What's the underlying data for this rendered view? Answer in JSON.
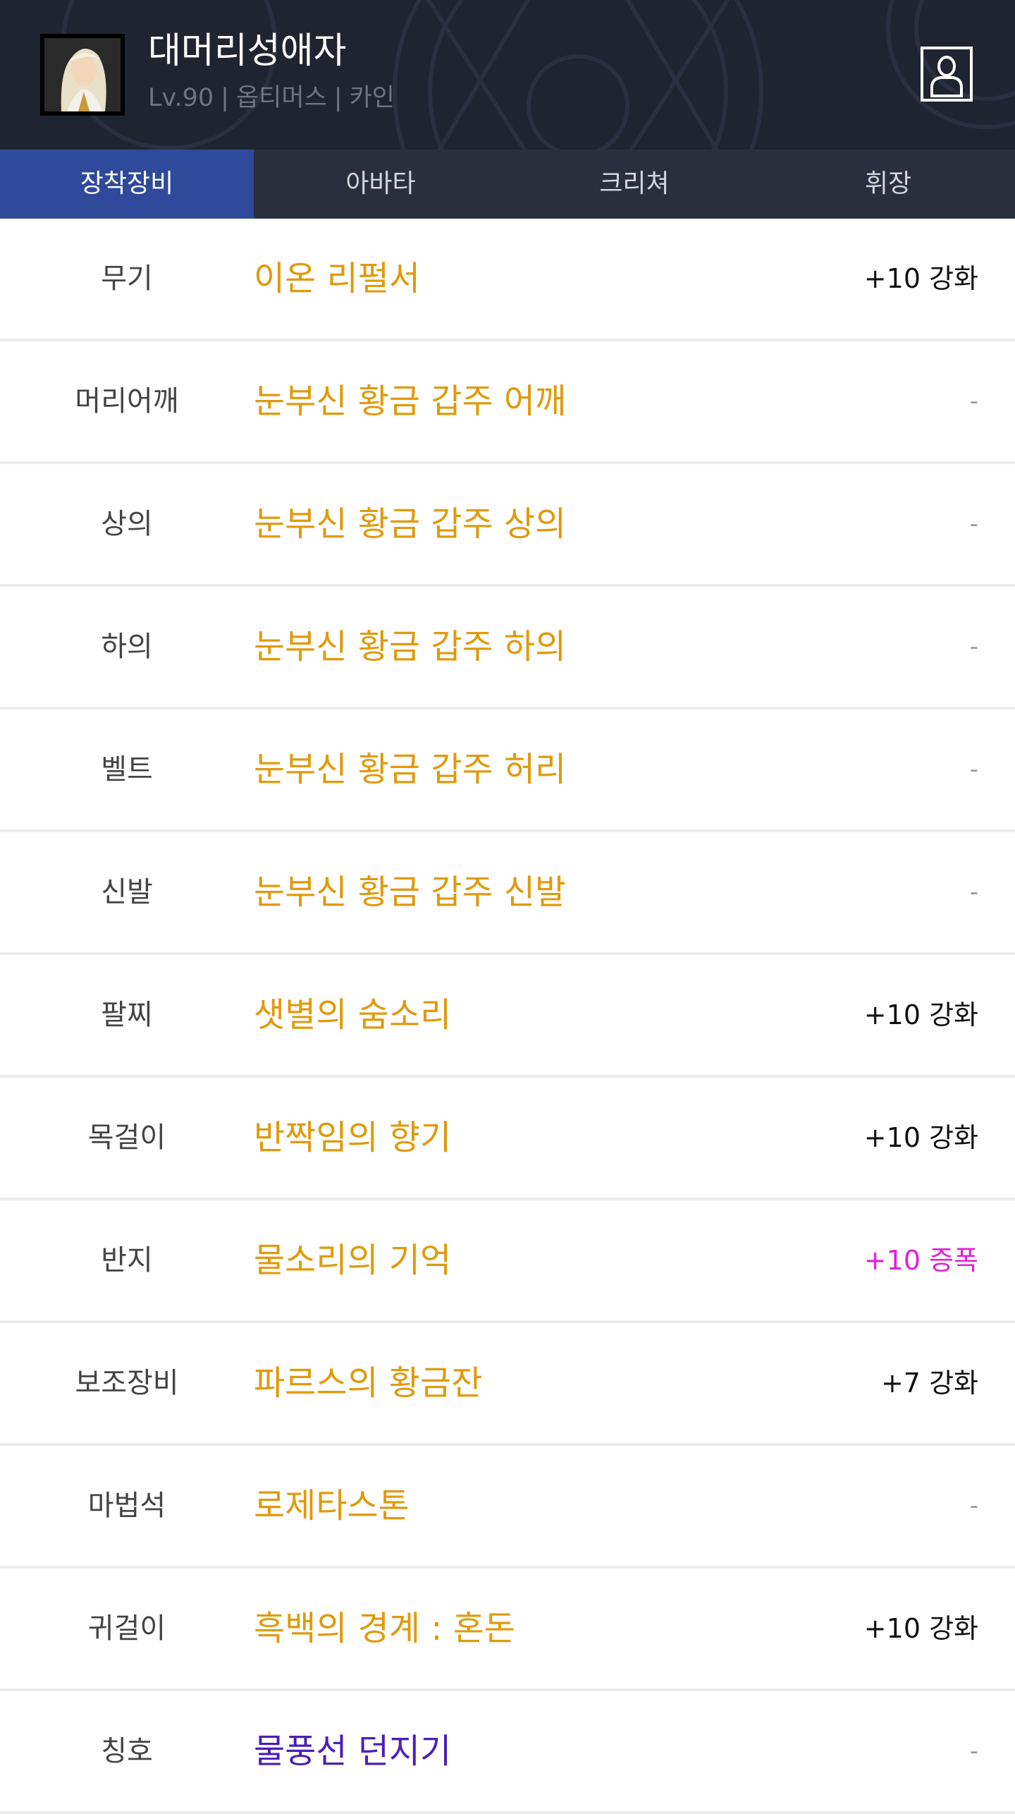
{
  "colors": {
    "header_bg": "#1f2431",
    "tab_bar_bg": "#2a2f3d",
    "tab_active_bg": "#2f4a9a",
    "unique_item": "#e09a0c",
    "title_item": "#4b1fb8",
    "amplify": "#e020d8",
    "reinforce": "#111111",
    "none": "#999999"
  },
  "profile": {
    "name": "대머리성애자",
    "level": "Lv.90",
    "job": "옵티머스",
    "server": "카인",
    "avatar_icon": "character-portrait-icon",
    "profile_button_icon": "person-icon"
  },
  "tabs": [
    {
      "label": "장착장비",
      "active": true
    },
    {
      "label": "아바타",
      "active": false
    },
    {
      "label": "크리쳐",
      "active": false
    },
    {
      "label": "휘장",
      "active": false
    }
  ],
  "equipment": [
    {
      "slot": "무기",
      "name": "이온 리펄서",
      "enchant": "+10 강화",
      "rarity": "unique",
      "enchant_type": "reinforce"
    },
    {
      "slot": "머리어깨",
      "name": "눈부신 황금 갑주 어깨",
      "enchant": "-",
      "rarity": "unique",
      "enchant_type": "none"
    },
    {
      "slot": "상의",
      "name": "눈부신 황금 갑주 상의",
      "enchant": "-",
      "rarity": "unique",
      "enchant_type": "none"
    },
    {
      "slot": "하의",
      "name": "눈부신 황금 갑주 하의",
      "enchant": "-",
      "rarity": "unique",
      "enchant_type": "none"
    },
    {
      "slot": "벨트",
      "name": "눈부신 황금 갑주 허리",
      "enchant": "-",
      "rarity": "unique",
      "enchant_type": "none"
    },
    {
      "slot": "신발",
      "name": "눈부신 황금 갑주 신발",
      "enchant": "-",
      "rarity": "unique",
      "enchant_type": "none"
    },
    {
      "slot": "팔찌",
      "name": "샛별의 숨소리",
      "enchant": "+10 강화",
      "rarity": "unique",
      "enchant_type": "reinforce"
    },
    {
      "slot": "목걸이",
      "name": "반짝임의 향기",
      "enchant": "+10 강화",
      "rarity": "unique",
      "enchant_type": "reinforce"
    },
    {
      "slot": "반지",
      "name": "물소리의 기억",
      "enchant": "+10 증폭",
      "rarity": "unique",
      "enchant_type": "amplify"
    },
    {
      "slot": "보조장비",
      "name": "파르스의 황금잔",
      "enchant": "+7 강화",
      "rarity": "unique",
      "enchant_type": "reinforce"
    },
    {
      "slot": "마법석",
      "name": "로제타스톤",
      "enchant": "-",
      "rarity": "unique",
      "enchant_type": "none"
    },
    {
      "slot": "귀걸이",
      "name": "흑백의 경계 : 혼돈",
      "enchant": "+10 강화",
      "rarity": "unique",
      "enchant_type": "reinforce"
    },
    {
      "slot": "칭호",
      "name": "물풍선 던지기",
      "enchant": "-",
      "rarity": "title",
      "enchant_type": "none"
    }
  ]
}
